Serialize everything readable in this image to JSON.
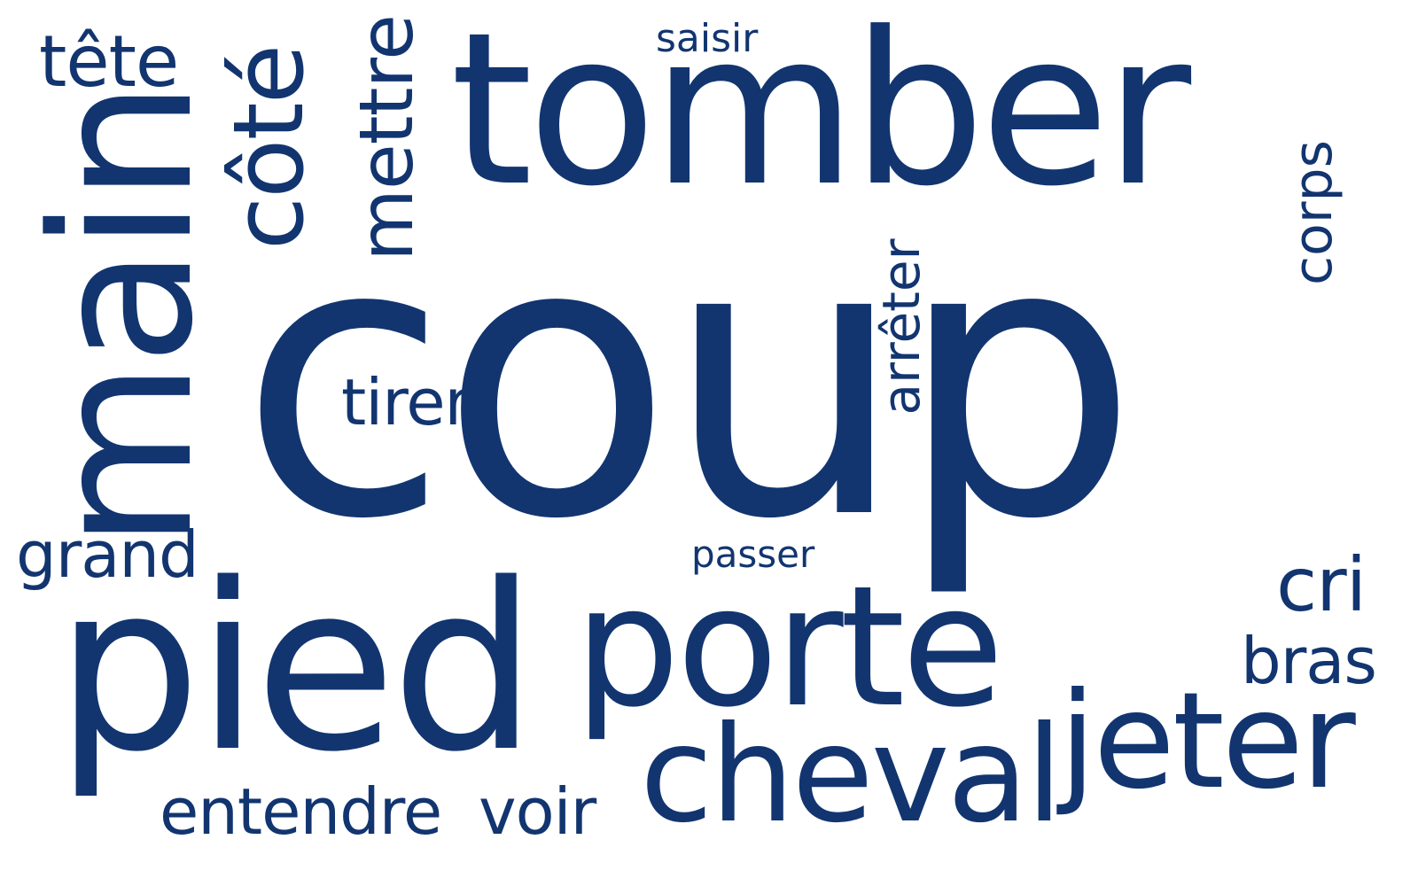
{
  "colors": {
    "word": "#123570",
    "background": "#ffffff"
  },
  "words": {
    "coup": "coup",
    "tomber": "tomber",
    "pied": "pied",
    "porte": "porte",
    "main": "main",
    "cheval": "cheval",
    "jeter": "jeter",
    "cote": "côté",
    "mettre": "mettre",
    "entendre": "entendre",
    "voir": "voir",
    "grand": "grand",
    "tete": "tête",
    "tirer": "tirer",
    "arreter": "arrêter",
    "corps": "corps",
    "saisir": "saisir",
    "passer": "passer",
    "cri": "cri",
    "bras": "bras"
  }
}
